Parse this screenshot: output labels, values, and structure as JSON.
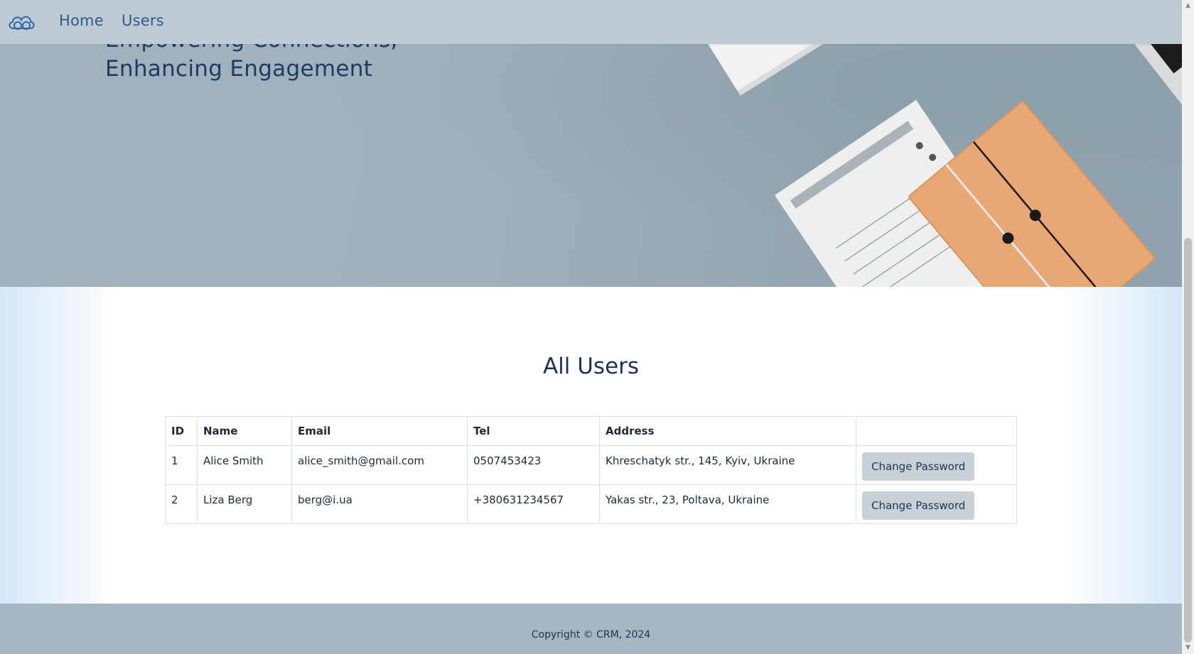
{
  "nav": {
    "links": [
      {
        "label": "Home"
      },
      {
        "label": "Users"
      }
    ]
  },
  "hero": {
    "line1": "Empowering Connections,",
    "line2": "Enhancing Engagement"
  },
  "users": {
    "title": "All Users",
    "columns": [
      "ID",
      "Name",
      "Email",
      "Tel",
      "Address",
      ""
    ],
    "rows": [
      {
        "id": "1",
        "name": "Alice Smith",
        "email": "alice_smith@gmail.com",
        "tel": "0507453423",
        "address": "Khreschatyk str., 145, Kyiv, Ukraine",
        "action": "Change Password"
      },
      {
        "id": "2",
        "name": "Liza Berg",
        "email": "berg@i.ua",
        "tel": "+380631234567",
        "address": "Yakas str., 23, Poltava, Ukraine",
        "action": "Change Password"
      }
    ]
  },
  "footer": {
    "text": "Copyright © CRM, 2024"
  },
  "colors": {
    "nav_bg": "#bfcbd4",
    "hero_bg": "#a2b3bf",
    "button_bg": "#c8d1d8",
    "footer_bg": "#a6b7c2",
    "text_dark": "#1f3350",
    "link": "#2d5a8f"
  },
  "icons": [
    "cloud-logo-icon"
  ]
}
